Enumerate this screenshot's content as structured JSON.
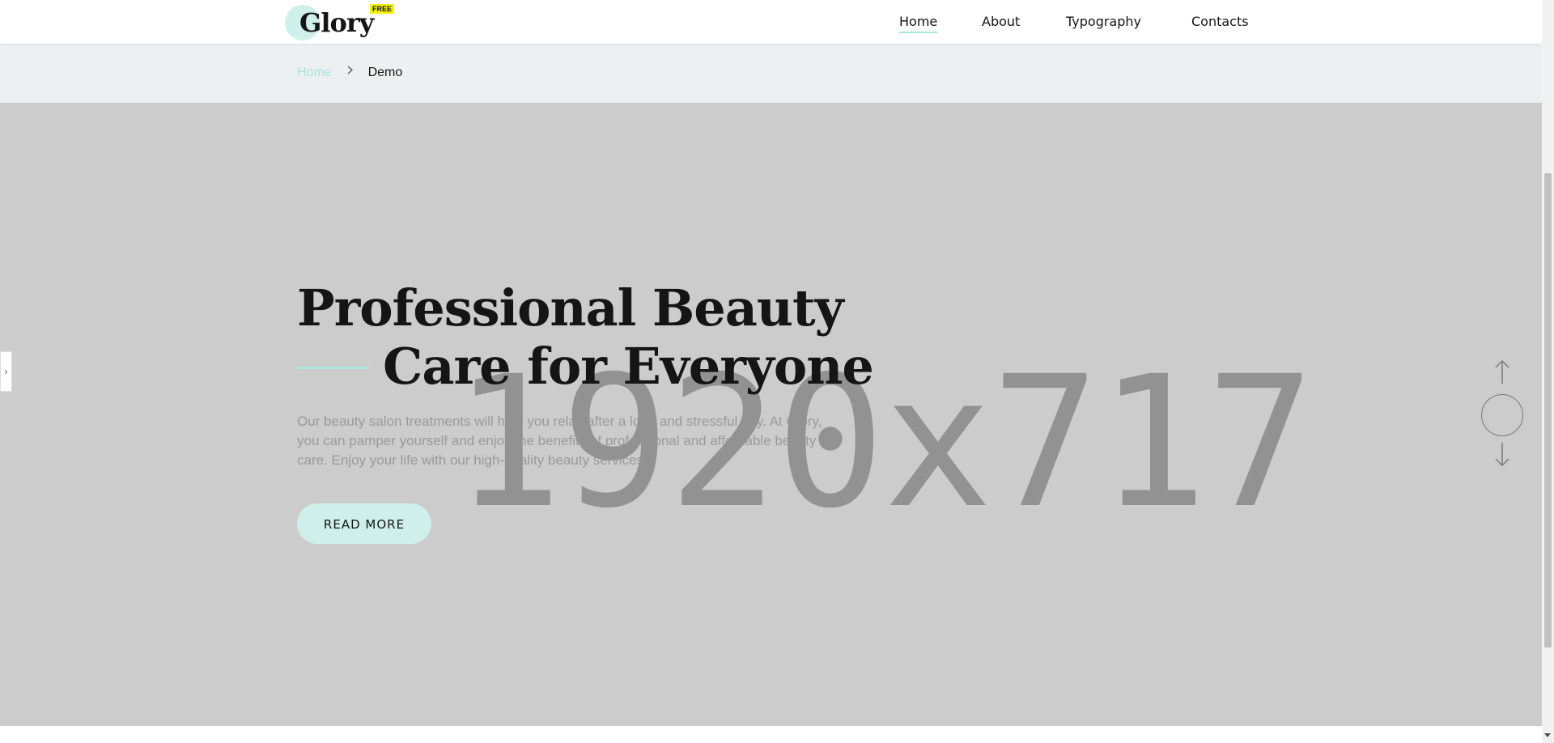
{
  "header": {
    "logo_text": "Glory",
    "logo_badge": "FREE",
    "nav": [
      {
        "label": "Home",
        "active": true
      },
      {
        "label": "About",
        "active": false
      },
      {
        "label": "Typography",
        "active": false
      },
      {
        "label": "Contacts",
        "active": false
      }
    ]
  },
  "breadcrumb": {
    "home": "Home",
    "separator_icon": "chevron-right-icon",
    "current": "Demo"
  },
  "hero": {
    "placeholder": "1920x717",
    "title_line1": "Professional Beauty",
    "title_line2": "Care for Everyone",
    "description": "Our beauty salon treatments will help you relax after a long and stressful day. At Glory, you can pamper yourself and enjoy the benefits of professional and affordable beauty care. Enjoy your life with our high-quality beauty services.",
    "button_label": "READ MORE"
  },
  "controls": {
    "side_tab_icon": "chevron-right-icon",
    "slider_up_icon": "arrow-up-icon",
    "slider_down_icon": "arrow-down-icon"
  },
  "colors": {
    "accent": "#a8e5da",
    "button_bg": "#cff0ea",
    "badge": "#f4f014",
    "hero_bg": "#cccccc",
    "breadcrumb_bg": "#edf0f1"
  }
}
